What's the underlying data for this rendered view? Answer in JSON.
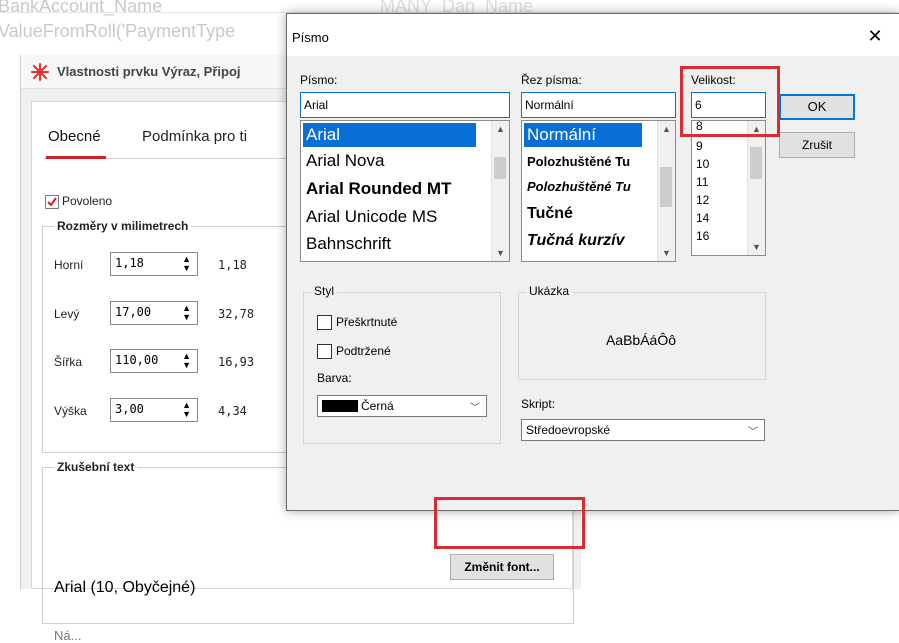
{
  "background": {
    "code_line_1": "BankAccount_Name",
    "code_line_2": "ValueFromRoll('PaymentType",
    "code_mid": "MANY_Dan_Name"
  },
  "property_window": {
    "title": "Vlastnosti prvku Výraz, Připoj",
    "tabs": [
      "Obecné",
      "Podmínka pro ti"
    ],
    "povoleno_label": "Povoleno",
    "povoleno_checked": true,
    "group_rozmery": "Rozměry v milimetrech",
    "fields": [
      {
        "label": "Horní",
        "value": "1,18",
        "extra": "1,18"
      },
      {
        "label": "Levý",
        "value": "17,00",
        "extra": "32,78"
      },
      {
        "label": "Šířka",
        "value": "110,00",
        "extra": "16,93"
      },
      {
        "label": "Výška",
        "value": "3,00",
        "extra": "4,34"
      }
    ],
    "group_zkusebni": "Zkušební text",
    "font_preview": "Arial (10, Obyčejné)",
    "change_font_button": "Změnit font...",
    "next_group_label": "Ná..."
  },
  "font_dialog": {
    "title": "Písmo",
    "close_glyph": "✕",
    "font_label": "Písmo:",
    "font_value": "Arial",
    "font_list": [
      "Arial",
      "Arial Nova",
      "Arial Rounded MT",
      "Arial Unicode MS",
      "Bahnschrift"
    ],
    "style_label": "Řez písma:",
    "style_value": "Normální",
    "style_list": [
      "Normální",
      "Polozhuštěné Tu",
      "Polozhuštěné Tu",
      "Tučné",
      "Tučná kurzív"
    ],
    "size_label": "Velikost:",
    "size_value": "6",
    "size_list": [
      "8",
      "9",
      "10",
      "11",
      "12",
      "14",
      "16"
    ],
    "ok_button": "OK",
    "cancel_button": "Zrušit",
    "styl_group": "Styl",
    "strike_label": "Přeškrtnuté",
    "underline_label": "Podtržené",
    "color_label": "Barva:",
    "color_value": "Černá",
    "sample_group": "Ukázka",
    "sample_text": "AaBbÁáÔô",
    "script_label": "Skript:",
    "script_value": "Středoevropské"
  },
  "colors": {
    "selection": "#0a6fd4",
    "highlight_box": "#d62d35",
    "accent_tab": "#d21f2a"
  }
}
